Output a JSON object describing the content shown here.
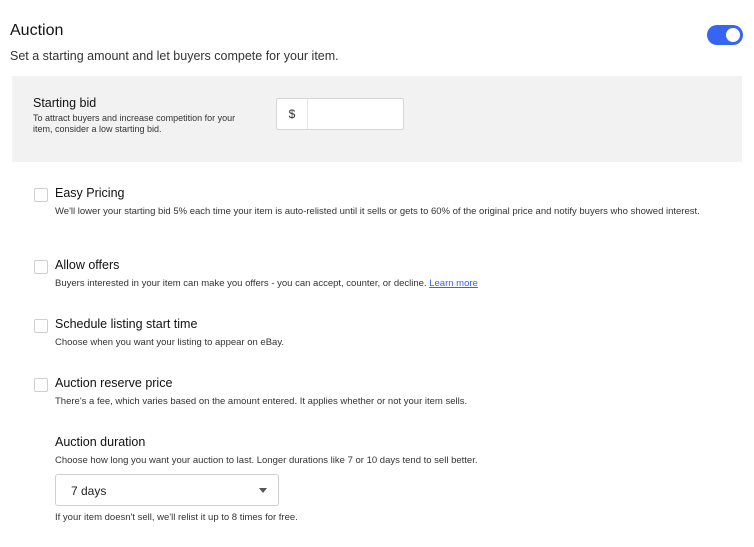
{
  "header": {
    "title": "Auction",
    "subtitle": "Set a starting amount and let buyers compete for your item.",
    "toggle_on": true,
    "accent_color": "#3665f3"
  },
  "starting_bid": {
    "label": "Starting bid",
    "help": "To attract buyers and increase competition for your item, consider a low starting bid.",
    "currency_symbol": "$",
    "value": ""
  },
  "options": [
    {
      "label": "Easy Pricing",
      "description": "We'll lower your starting bid 5% each time your item is auto-relisted until it sells or gets to 60% of the original price and notify buyers who showed interest.",
      "checked": false
    },
    {
      "label": "Allow offers",
      "description": "Buyers interested in your item can make you offers - you can accept, counter, or decline.",
      "link": "Learn more",
      "checked": false
    },
    {
      "label": "Schedule listing start time",
      "description": "Choose when you want your listing to appear on eBay.",
      "checked": false
    },
    {
      "label": "Auction reserve price",
      "description": "There's a fee, which varies based on the amount entered. It applies whether or not your item sells.",
      "checked": false
    }
  ],
  "duration": {
    "label": "Auction duration",
    "description": "Choose how long you want your auction to last. Longer durations like 7 or 10 days tend to sell better.",
    "selected": "7 days",
    "note": "If your item doesn't sell, we'll relist it up to 8 times for free."
  }
}
